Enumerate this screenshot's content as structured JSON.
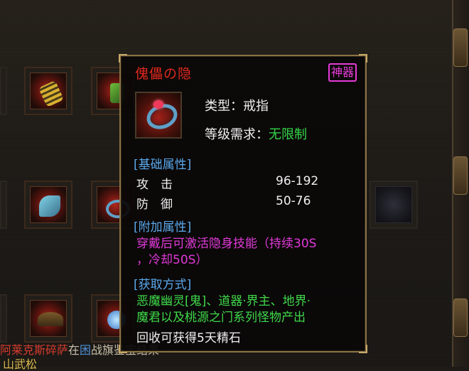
{
  "tooltip": {
    "item_name": "傀儡の隐",
    "badge": "神器",
    "type_label": "类型：戒指",
    "level_label": "等级需求：",
    "level_value": "无限制",
    "section_basic": "[基础属性]",
    "attack_label": "攻　击",
    "attack_value": "96-192",
    "defense_label": "防　御",
    "defense_value": "50-76",
    "section_extra": "[附加属性]",
    "extra_line1": "穿戴后可激活隐身技能（持续30S",
    "extra_line2": "，冷却50S）",
    "section_source": "[获取方式]",
    "source_line1": "恶魔幽灵[鬼]、道器·界主、地界·",
    "source_line2": "魔君以及桃源之门系列怪物产出",
    "recycle": "回收可获得5天精石"
  },
  "chat": {
    "line1_red": "阿莱克斯碎萨",
    "line1_mid": "在",
    "line1_blue": "困",
    "line1_tail": "战旗鉴宝结果",
    "line2": "山武松"
  },
  "colors": {
    "name": "#e0281e",
    "badge": "#e63bd8",
    "section": "#5aa8ec",
    "green": "#3fd84a",
    "magenta": "#e03ad8",
    "frame": "#8a7245"
  },
  "icons": [
    "ring-item-icon",
    "gauntlet-item-icon",
    "helmet-item-icon",
    "boots-item-icon"
  ]
}
